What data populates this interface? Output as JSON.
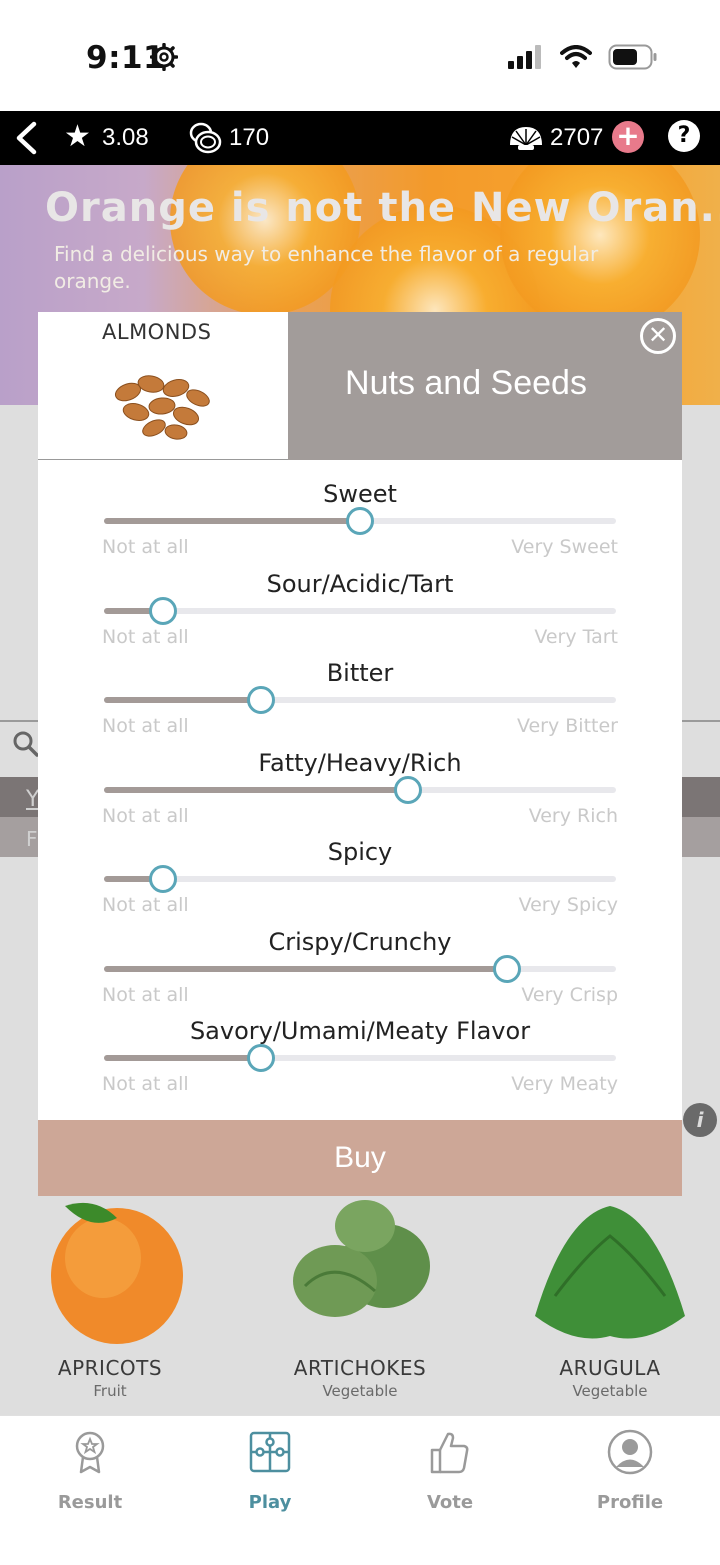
{
  "status_bar": {
    "time": "9:11"
  },
  "top_bar": {
    "rating": "3.08",
    "coins": "170",
    "shells": "2707",
    "plus": "+",
    "help": "?",
    "star": "★"
  },
  "challenge": {
    "title": "Orange is not the New Oran...",
    "description": "Find a delicious way to enhance the flavor of a regular orange."
  },
  "background": {
    "band_dark_text": "Y",
    "band_mid_text": "F",
    "info": "i"
  },
  "modal": {
    "item_name": "ALMONDS",
    "category": "Nuts and Seeds",
    "close": "✕",
    "buy_label": "Buy",
    "sliders": [
      {
        "label": "Sweet",
        "min": "Not at all",
        "max": "Very Sweet",
        "value": 0.5
      },
      {
        "label": "Sour/Acidic/Tart",
        "min": "Not at all",
        "max": "Very Tart",
        "value": 0.115
      },
      {
        "label": "Bitter",
        "min": "Not at all",
        "max": "Very Bitter",
        "value": 0.307
      },
      {
        "label": "Fatty/Heavy/Rich",
        "min": "Not at all",
        "max": "Very Rich",
        "value": 0.593
      },
      {
        "label": "Spicy",
        "min": "Not at all",
        "max": "Very Spicy",
        "value": 0.115
      },
      {
        "label": "Crispy/Crunchy",
        "min": "Not at all",
        "max": "Very Crisp",
        "value": 0.787
      },
      {
        "label": "Savory/Umami/Meaty Flavor",
        "min": "Not at all",
        "max": "Very Meaty",
        "value": 0.307
      }
    ]
  },
  "foods": [
    {
      "name": "APRICOTS",
      "category": "Fruit"
    },
    {
      "name": "ARTICHOKES",
      "category": "Vegetable"
    },
    {
      "name": "ARUGULA",
      "category": "Vegetable"
    }
  ],
  "bottom_nav": [
    {
      "label": "Result",
      "icon": "award-icon",
      "active": false
    },
    {
      "label": "Play",
      "icon": "puzzle-icon",
      "active": true
    },
    {
      "label": "Vote",
      "icon": "thumbs-up-icon",
      "active": false
    },
    {
      "label": "Profile",
      "icon": "profile-icon",
      "active": false
    }
  ],
  "colors": {
    "accent": "#5aa6b8",
    "buy": "#cda797",
    "category_panel": "#a29c9a",
    "plus": "#e87a8b",
    "nav_active": "#4d8f9f"
  }
}
